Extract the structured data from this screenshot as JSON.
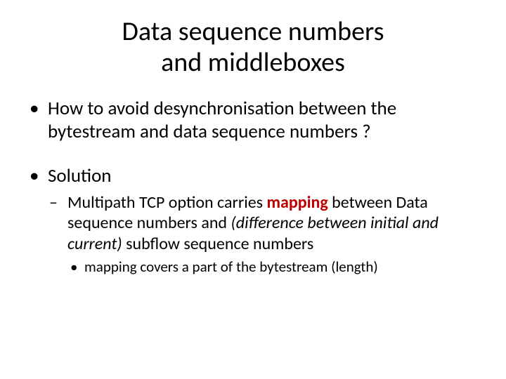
{
  "title_line1": "Data sequence numbers",
  "title_line2": "and middleboxes",
  "b1": "How to avoid desynchronisation between the bytestream and data sequence numbers ?",
  "b2": {
    "label": "Solution",
    "sub": {
      "pre": "Multipath TCP option carries ",
      "hl": "mapping",
      "mid1": " between Data sequence numbers and ",
      "ital": "(difference between initial and current)",
      "mid2": " subflow sequence numbers",
      "subsub": "mapping covers a part of the bytestream (length)"
    }
  }
}
